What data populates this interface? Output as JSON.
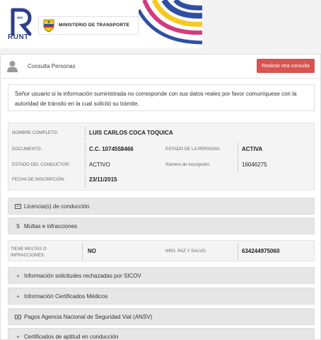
{
  "header": {
    "runt_logo_text": "RUNT",
    "ministry_text": "MINISTERIO DE TRANSPORTE"
  },
  "toolbar": {
    "title": "Consulta Personas",
    "realizar_label": "Realizar otra consulta"
  },
  "notice": {
    "text": "Señor usuario si la información suministrada no corresponde con sus datos reales por favor comuníquese con la autoridad de tránsito en la cual solicitó su trámite."
  },
  "persona": {
    "nombre_label": "NOMBRE COMPLETO:",
    "nombre_value": "LUIS CARLOS COCA TOQUICA",
    "documento_label": "DOCUMENTO:",
    "documento_value": "C.C. 1074558466",
    "estado_persona_label": "ESTADO DE LA PERSONA:",
    "estado_persona_value": "ACTIVA",
    "estado_conductor_label": "ESTADO DEL CONDUCTOR:",
    "estado_conductor_value": "ACTIVO",
    "inscripcion_num_label": "Número de inscripción:",
    "inscripcion_num_value": "16046275",
    "fecha_label": "FECHA DE INSCRIPCIÓN:",
    "fecha_value": "23/11/2015"
  },
  "sections": {
    "licencias": "Licencia(s) de conducción",
    "multas": "Multas e infracciones",
    "sicov": "Información solicitudes rechazadas por SICOV",
    "medicos": "Información Certificados Médicos",
    "ansv": "Pagos Agencia Nacional de Seguridad Vial (ANSV)",
    "aptitud": "Certificados de aptitud en conducción"
  },
  "multas": {
    "tiene_label": "TIENE MULTAS O INFRACCIONES:",
    "tiene_value": "NO",
    "paz_label": "NRO. PAZ Y SALVO:",
    "paz_value": "634244975060"
  },
  "icons": {
    "licencias": "card-icon",
    "multas": "dollar-icon",
    "sicov": "plus-icon",
    "medicos": "plus-icon",
    "ansv": "payment-icon",
    "aptitud": "plus-icon"
  },
  "colors": {
    "runt_blue": "#2d3e8c",
    "button_red": "#d9534f",
    "wave_blue": "#2e4fa3",
    "wave_yellow": "#f7c81d",
    "wave_pink": "#d23b7e"
  }
}
